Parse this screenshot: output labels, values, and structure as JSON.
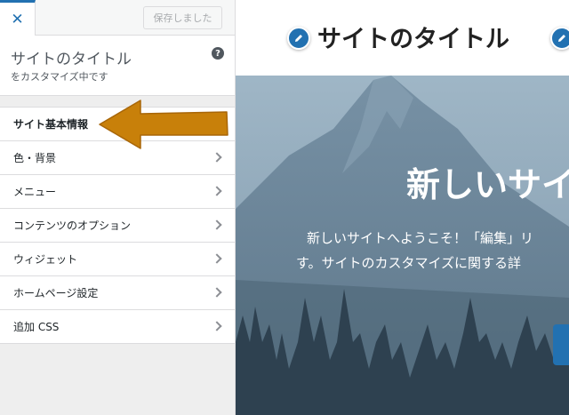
{
  "topbar": {
    "close_glyph": "✕",
    "saved_label": "保存しました"
  },
  "info": {
    "title": "サイトのタイトル",
    "subtitle": "をカスタマイズ中です",
    "help_glyph": "?"
  },
  "sections": [
    {
      "label": "サイト基本情報"
    },
    {
      "label": "色・背景"
    },
    {
      "label": "メニュー"
    },
    {
      "label": "コンテンツのオプション"
    },
    {
      "label": "ウィジェット"
    },
    {
      "label": "ホームページ設定"
    },
    {
      "label": "追加 CSS"
    }
  ],
  "annotation": {
    "arrow_color": "#c8800a",
    "icon": "arrow-left-icon"
  },
  "preview": {
    "site_title": "サイトのタイトル",
    "hero_title": "新しいサイ",
    "hero_text_line1": "新しいサイトへようこそ！「編集」リ",
    "hero_text_line2": "す。サイトのカスタマイズに関する詳",
    "accent_color": "#2271b1"
  }
}
